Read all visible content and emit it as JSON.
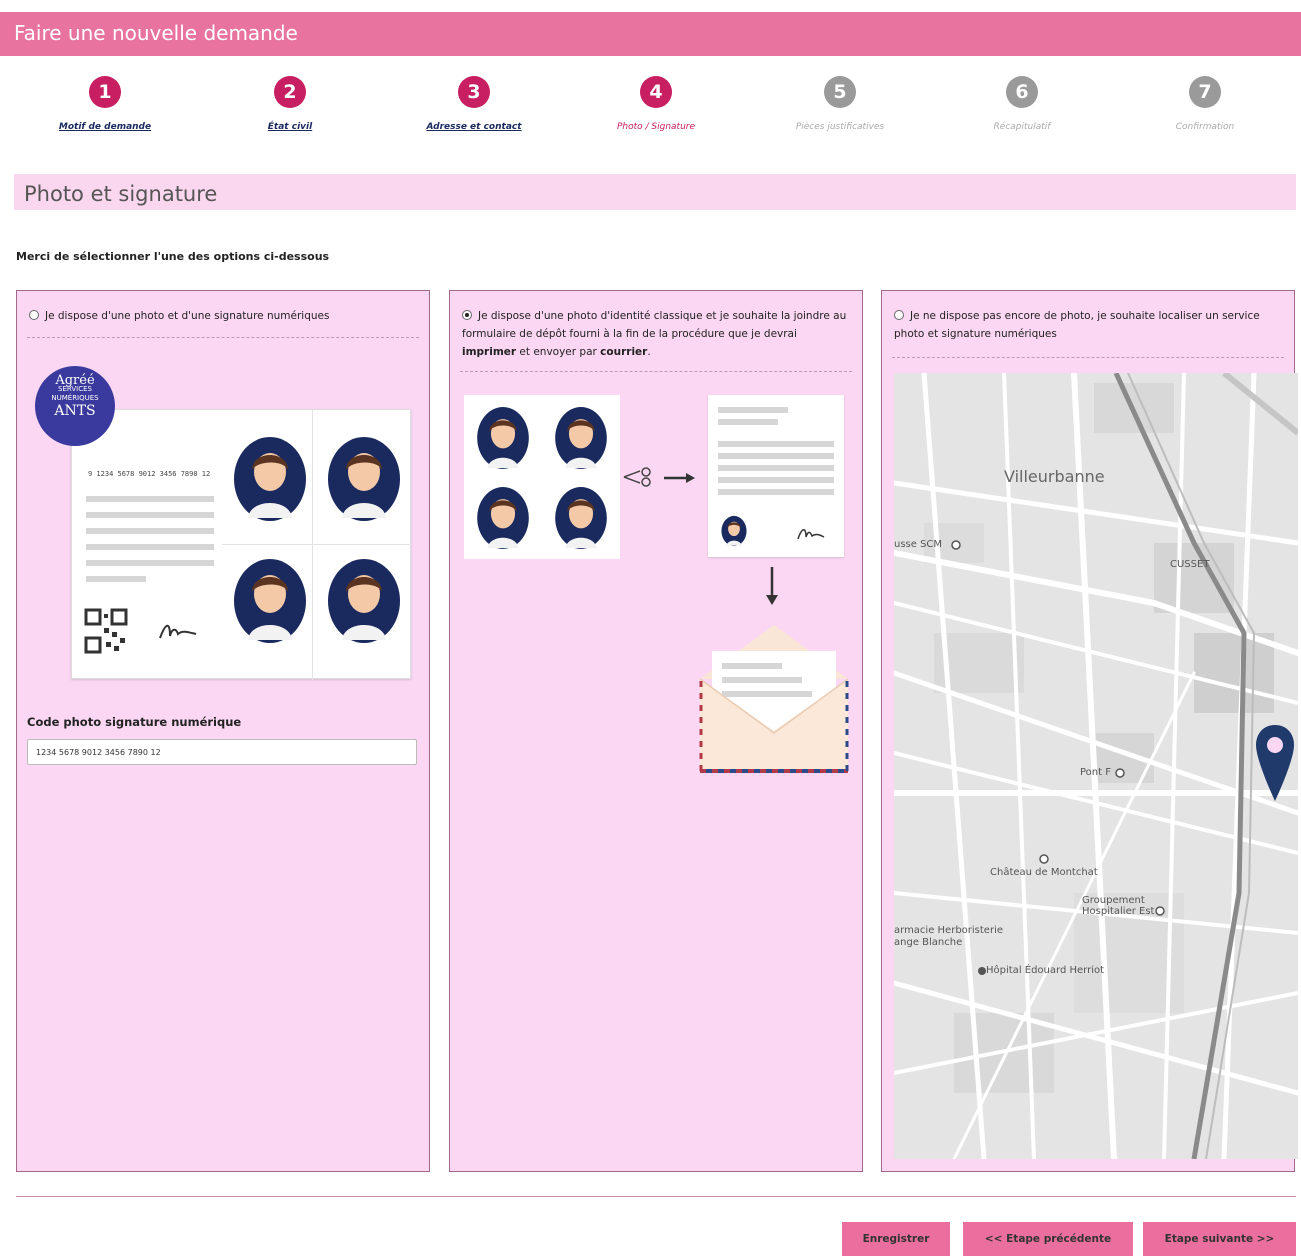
{
  "header": {
    "title": "Faire une nouvelle demande"
  },
  "steps": [
    {
      "num": "1",
      "label": "Motif de demande",
      "state": "done"
    },
    {
      "num": "2",
      "label": "État civil",
      "state": "done"
    },
    {
      "num": "3",
      "label": "Adresse et contact",
      "state": "done"
    },
    {
      "num": "4",
      "label": "Photo / Signature",
      "state": "current"
    },
    {
      "num": "5",
      "label": "Pièces justificatives",
      "state": "todo"
    },
    {
      "num": "6",
      "label": "Récapitulatif",
      "state": "todo"
    },
    {
      "num": "7",
      "label": "Confirmation",
      "state": "todo"
    }
  ],
  "section": {
    "title": "Photo et signature"
  },
  "instruction": "Merci de sélectionner l'une des options ci-dessous",
  "options": [
    {
      "label": "Je dispose d'une photo et d'une signature numériques",
      "selected": false
    },
    {
      "label_part1": "Je dispose d'une photo d'identité classique et je souhaite la joindre au formulaire de dépôt fourni à la fin de la procédure que je devrai ",
      "label_bold1": "imprimer",
      "label_part2": " et envoyer par ",
      "label_bold2": "courrier",
      "label_part3": ".",
      "selected": true
    },
    {
      "label": "Je ne dispose pas encore de photo, je souhaite localiser un service photo et signature numériques",
      "selected": false
    }
  ],
  "code_field": {
    "label": "Code photo signature numérique",
    "value": "1234 5678 9012 3456 7890 12"
  },
  "card": {
    "code": "9 1234 5678 9012 3456 7890 12"
  },
  "seal": {
    "top": "Agréé",
    "middle": "SERVICES NUMÉRIQUES",
    "bottom": "ANTS"
  },
  "map": {
    "labels": {
      "villeurbanne": "Villeurbanne",
      "cusset": "CUSSET",
      "pont_f": "Pont F",
      "chateau": "Château de Montchat",
      "groupement": "Groupement Hospitalier Est",
      "hopital": "Hôpital Édouard Herriot",
      "pharmacie": "armacie Herboristerie ange Blanche",
      "busse_scm": "usse SCM"
    },
    "pin_color": "#1f3a6b"
  },
  "buttons": {
    "save": "Enregistrer",
    "prev": "<< Etape précédente",
    "next": "Etape suivante >>"
  },
  "colors": {
    "accent": "#e9739f",
    "step_active": "#c81e62",
    "panel_bg": "#fbd7f3"
  }
}
